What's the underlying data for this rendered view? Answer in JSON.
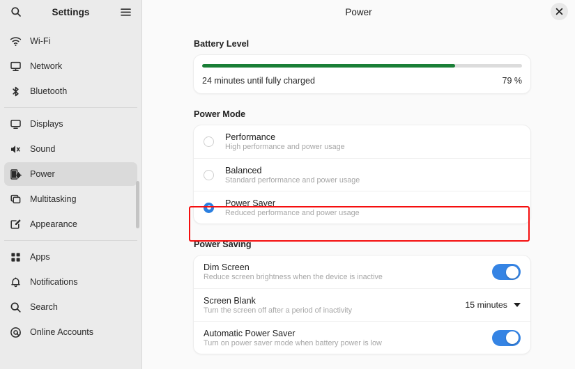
{
  "sidebar": {
    "title": "Settings",
    "search_icon": "search-icon",
    "menu_icon": "hamburger-menu-icon",
    "groups": [
      {
        "items": [
          {
            "label": "Wi-Fi",
            "icon": "wifi-icon",
            "selected": false
          },
          {
            "label": "Network",
            "icon": "network-icon",
            "selected": false
          },
          {
            "label": "Bluetooth",
            "icon": "bluetooth-icon",
            "selected": false
          }
        ]
      },
      {
        "items": [
          {
            "label": "Displays",
            "icon": "display-icon",
            "selected": false
          },
          {
            "label": "Sound",
            "icon": "sound-icon",
            "selected": false
          },
          {
            "label": "Power",
            "icon": "power-icon",
            "selected": true
          },
          {
            "label": "Multitasking",
            "icon": "multitasking-icon",
            "selected": false
          },
          {
            "label": "Appearance",
            "icon": "appearance-icon",
            "selected": false
          }
        ]
      },
      {
        "items": [
          {
            "label": "Apps",
            "icon": "apps-icon",
            "selected": false
          },
          {
            "label": "Notifications",
            "icon": "bell-icon",
            "selected": false
          },
          {
            "label": "Search",
            "icon": "search-icon",
            "selected": false
          },
          {
            "label": "Online Accounts",
            "icon": "at-sign-icon",
            "selected": false
          }
        ]
      }
    ]
  },
  "header": {
    "title": "Power",
    "close_label": "×"
  },
  "battery": {
    "section_title": "Battery Level",
    "status": "24 minutes until fully charged",
    "percent_label": "79 %",
    "percent_value": 79,
    "bar_color": "#1a7f37"
  },
  "power_mode": {
    "section_title": "Power Mode",
    "options": [
      {
        "title": "Performance",
        "subtitle": "High performance and power usage",
        "selected": false
      },
      {
        "title": "Balanced",
        "subtitle": "Standard performance and power usage",
        "selected": false
      },
      {
        "title": "Power Saver",
        "subtitle": "Reduced performance and power usage",
        "selected": true
      }
    ],
    "highlight_color": "#f50e0e"
  },
  "power_saving": {
    "section_title": "Power Saving",
    "rows": [
      {
        "title": "Dim Screen",
        "subtitle": "Reduce screen brightness when the device is inactive",
        "control": "toggle",
        "value": "on"
      },
      {
        "title": "Screen Blank",
        "subtitle": "Turn the screen off after a period of inactivity",
        "control": "dropdown",
        "value": "15 minutes"
      },
      {
        "title": "Automatic Power Saver",
        "subtitle": "Turn on power saver mode when battery power is low",
        "control": "toggle",
        "value": "on"
      }
    ]
  },
  "accent_color": "#3584e4"
}
